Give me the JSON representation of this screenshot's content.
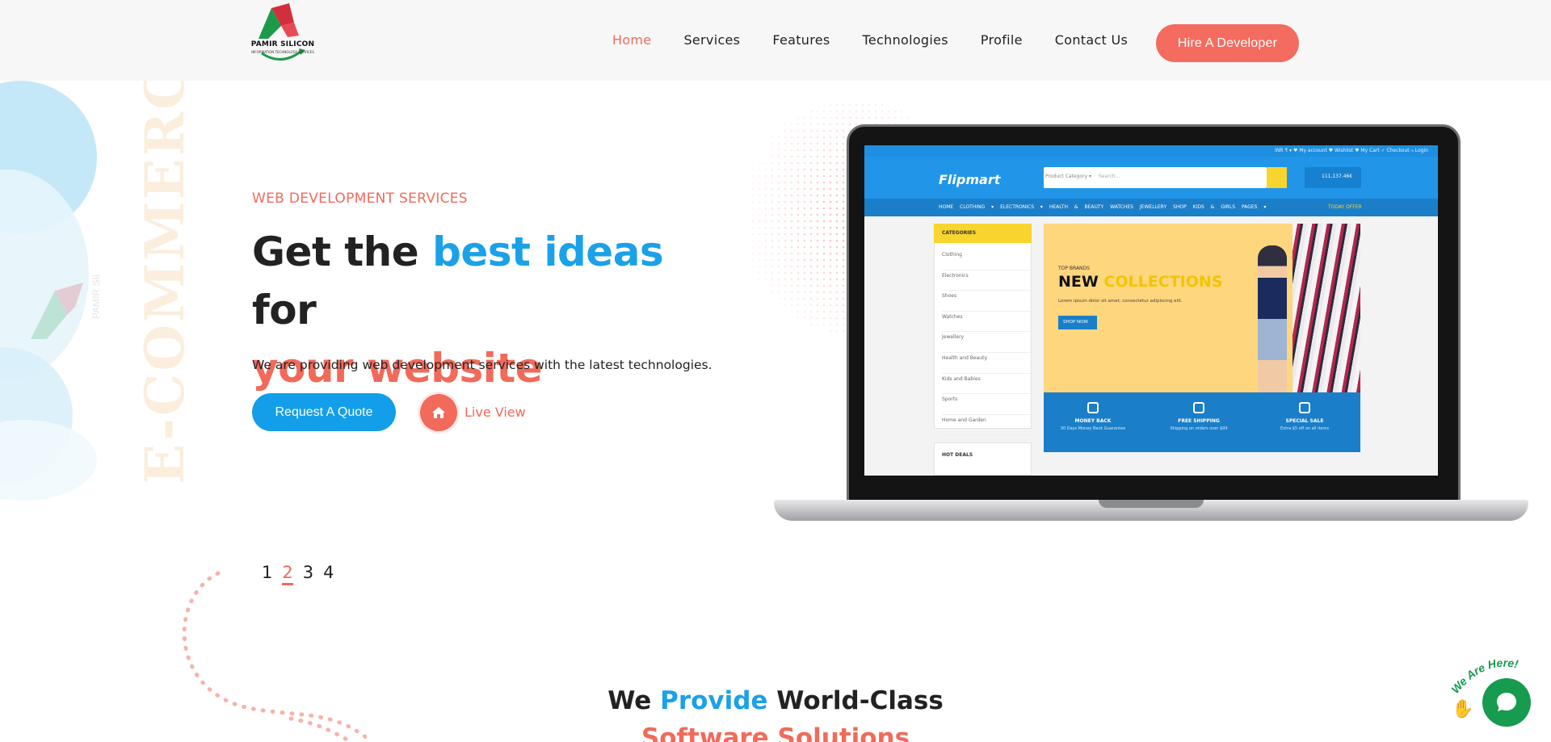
{
  "brand": {
    "logo_text": "PAMIR SILICON",
    "logo_subtext": "INFORMATION TECHNOLOGY SERVICES"
  },
  "nav": {
    "items": [
      "Home",
      "Services",
      "Features",
      "Technologies",
      "Profile",
      "Contact Us"
    ],
    "active": "Home",
    "hire_button": "Hire A Developer"
  },
  "hero": {
    "eyebrow": "WEB DEVELOPMENT SERVICES",
    "title_part1": "Get the ",
    "title_highlight": "best ideas",
    "title_part2": " for",
    "title_line2": "your website",
    "description": "We are providing web development services with the latest technologies.",
    "quote_button": "Request A Quote",
    "live_view": "Live View",
    "background_word": "E-COMMERCE"
  },
  "mockup": {
    "top_links": "INR ₹   ▾   ♥ My account   ♥ Wishlist   ♥ My Cart   ✓ Checkout   ⤷ Login",
    "logo": "Flipmart",
    "search_category": "Product Category ▾",
    "search_placeholder": "Search...",
    "cart": "111,137.46€",
    "nav_items": [
      "HOME",
      "CLOTHING ▾",
      "ELECTRONICS ▾",
      "HEALTH & BEAUTY",
      "WATCHES",
      "JEWELLERY",
      "SHOP",
      "KIDS & GIRLS",
      "PAGES ▾"
    ],
    "today_offer": "TODAY OFFER",
    "categories_title": "CATEGORIES",
    "categories": [
      "Clothing",
      "Electronics",
      "Shoes",
      "Watches",
      "Jewellery",
      "Health and Beauty",
      "Kids and Babies",
      "Sports",
      "Home and Garden"
    ],
    "hot_deals": "HOT DEALS",
    "banner_brand": "TOP BRANDS",
    "banner_new": "NEW",
    "banner_collections": " COLLECTIONS",
    "banner_lorem": "Lorem ipsum dolor sit amet, consectetur adipiscing elit.",
    "banner_shop": "SHOP NOW",
    "features": [
      {
        "title": "MONEY BACK",
        "sub": "30 Days Money Back Guarantee"
      },
      {
        "title": "FREE SHIPPING",
        "sub": "Shipping on orders over $99"
      },
      {
        "title": "SPECIAL SALE",
        "sub": "Extra $5 off on all items"
      }
    ]
  },
  "pager": {
    "pages": [
      "1",
      "2",
      "3",
      "4"
    ],
    "active": "2"
  },
  "section": {
    "title_part1": "We ",
    "title_highlight": "Provide",
    "title_part2": " World-Class",
    "subtitle": "Software Solutions"
  },
  "chat": {
    "label": "We Are Here!"
  },
  "colors": {
    "accent_coral": "#f26a5a",
    "accent_blue": "#1aa1e8",
    "chat_green": "#169b4f"
  }
}
